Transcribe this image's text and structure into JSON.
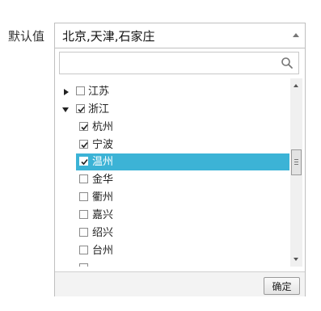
{
  "field": {
    "label": "默认值",
    "value": "北京,天津,石家庄"
  },
  "search": {
    "placeholder": "",
    "value": ""
  },
  "tree": {
    "items": [
      {
        "label": "江苏",
        "level": 0,
        "toggle": "collapsed",
        "checked": false,
        "selected": false
      },
      {
        "label": "浙江",
        "level": 0,
        "toggle": "expanded",
        "checked": true,
        "selected": false
      },
      {
        "label": "杭州",
        "level": 1,
        "checked": true,
        "selected": false
      },
      {
        "label": "宁波",
        "level": 1,
        "checked": true,
        "selected": false
      },
      {
        "label": "温州",
        "level": 1,
        "checked": true,
        "selected": true
      },
      {
        "label": "金华",
        "level": 1,
        "checked": false,
        "selected": false
      },
      {
        "label": "衢州",
        "level": 1,
        "checked": false,
        "selected": false
      },
      {
        "label": "嘉兴",
        "level": 1,
        "checked": false,
        "selected": false
      },
      {
        "label": "绍兴",
        "level": 1,
        "checked": false,
        "selected": false
      },
      {
        "label": "台州",
        "level": 1,
        "checked": false,
        "selected": false
      }
    ]
  },
  "footer": {
    "confirm_label": "确定"
  },
  "colors": {
    "selection": "#3cb3d6"
  }
}
